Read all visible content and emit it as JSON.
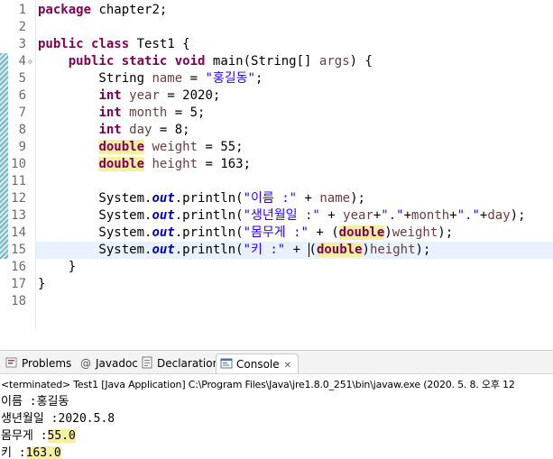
{
  "editor": {
    "line_numbers": [
      "1",
      "2",
      "3",
      "4",
      "5",
      "6",
      "7",
      "8",
      "9",
      "10",
      "11",
      "12",
      "13",
      "14",
      "15",
      "16",
      "17",
      "18"
    ],
    "lines": [
      [
        {
          "t": "package",
          "c": "kw"
        },
        {
          "t": " chapter2;"
        }
      ],
      [],
      [
        {
          "t": "public",
          "c": "kw"
        },
        {
          "t": " "
        },
        {
          "t": "class",
          "c": "kw"
        },
        {
          "t": " Test1 {"
        }
      ],
      [
        {
          "t": "    "
        },
        {
          "t": "public",
          "c": "kw"
        },
        {
          "t": " "
        },
        {
          "t": "static",
          "c": "kw"
        },
        {
          "t": " "
        },
        {
          "t": "void",
          "c": "kw"
        },
        {
          "t": " main(String[] "
        },
        {
          "t": "args",
          "c": "var"
        },
        {
          "t": ") {"
        }
      ],
      [
        {
          "t": "        String "
        },
        {
          "t": "name",
          "c": "var"
        },
        {
          "t": " = "
        },
        {
          "t": "\"홍길동\"",
          "c": "str"
        },
        {
          "t": ";"
        }
      ],
      [
        {
          "t": "        "
        },
        {
          "t": "int",
          "c": "kw"
        },
        {
          "t": " "
        },
        {
          "t": "year",
          "c": "var"
        },
        {
          "t": " = 2020;"
        }
      ],
      [
        {
          "t": "        "
        },
        {
          "t": "int",
          "c": "kw"
        },
        {
          "t": " "
        },
        {
          "t": "month",
          "c": "var"
        },
        {
          "t": " = 5;"
        }
      ],
      [
        {
          "t": "        "
        },
        {
          "t": "int",
          "c": "kw"
        },
        {
          "t": " "
        },
        {
          "t": "day",
          "c": "var"
        },
        {
          "t": " = 8;"
        }
      ],
      [
        {
          "t": "        "
        },
        {
          "t": "double",
          "c": "kw mark"
        },
        {
          "t": " "
        },
        {
          "t": "weight",
          "c": "var"
        },
        {
          "t": " = 55;"
        }
      ],
      [
        {
          "t": "        "
        },
        {
          "t": "double",
          "c": "kw mark"
        },
        {
          "t": " "
        },
        {
          "t": "height",
          "c": "var"
        },
        {
          "t": " = 163;"
        }
      ],
      [],
      [
        {
          "t": "        System."
        },
        {
          "t": "out",
          "c": "fld"
        },
        {
          "t": ".println("
        },
        {
          "t": "\"이름 :\"",
          "c": "str"
        },
        {
          "t": " + "
        },
        {
          "t": "name",
          "c": "var"
        },
        {
          "t": ");"
        }
      ],
      [
        {
          "t": "        System."
        },
        {
          "t": "out",
          "c": "fld"
        },
        {
          "t": ".println("
        },
        {
          "t": "\"생년월일 :\"",
          "c": "str"
        },
        {
          "t": " + "
        },
        {
          "t": "year",
          "c": "var"
        },
        {
          "t": "+"
        },
        {
          "t": "\".\"",
          "c": "str"
        },
        {
          "t": "+"
        },
        {
          "t": "month",
          "c": "var"
        },
        {
          "t": "+"
        },
        {
          "t": "\".\"",
          "c": "str"
        },
        {
          "t": "+"
        },
        {
          "t": "day",
          "c": "var"
        },
        {
          "t": ");"
        }
      ],
      [
        {
          "t": "        System."
        },
        {
          "t": "out",
          "c": "fld"
        },
        {
          "t": ".println("
        },
        {
          "t": "\"몸무게 :\"",
          "c": "str"
        },
        {
          "t": " + ("
        },
        {
          "t": "double",
          "c": "kw mark"
        },
        {
          "t": ")"
        },
        {
          "t": "weight",
          "c": "var"
        },
        {
          "t": ");"
        }
      ],
      [
        {
          "t": "        System."
        },
        {
          "t": "out",
          "c": "fld"
        },
        {
          "t": ".println("
        },
        {
          "t": "\"키 :\"",
          "c": "str"
        },
        {
          "t": " + "
        },
        {
          "t": "(",
          "c": "cursor"
        },
        {
          "t": "double",
          "c": "kw mark"
        },
        {
          "t": ")"
        },
        {
          "t": "height",
          "c": "var"
        },
        {
          "t": ");"
        }
      ],
      [
        {
          "t": "    }"
        }
      ],
      [
        {
          "t": "}"
        }
      ],
      []
    ]
  },
  "tabs": [
    {
      "label": "Problems",
      "icon": "problems-icon",
      "active": false
    },
    {
      "label": "Javadoc",
      "icon": "javadoc-icon",
      "active": false
    },
    {
      "label": "Declaration",
      "icon": "declaration-icon",
      "active": false
    },
    {
      "label": "Console",
      "icon": "console-icon",
      "active": true
    }
  ],
  "console": {
    "header": "<terminated> Test1 [Java Application] C:\\Program Files\\Java\\jre1.8.0_251\\bin\\javaw.exe  (2020. 5. 8. 오후 12",
    "output": [
      {
        "label": "이름 :",
        "value": "홍길동",
        "hl": false
      },
      {
        "label": "생년월일 :",
        "value": "2020.5.8",
        "hl": false
      },
      {
        "label": "몸무게 :",
        "value": "55.0",
        "hl": true
      },
      {
        "label": "키 :",
        "value": "163.0",
        "hl": true
      }
    ]
  }
}
